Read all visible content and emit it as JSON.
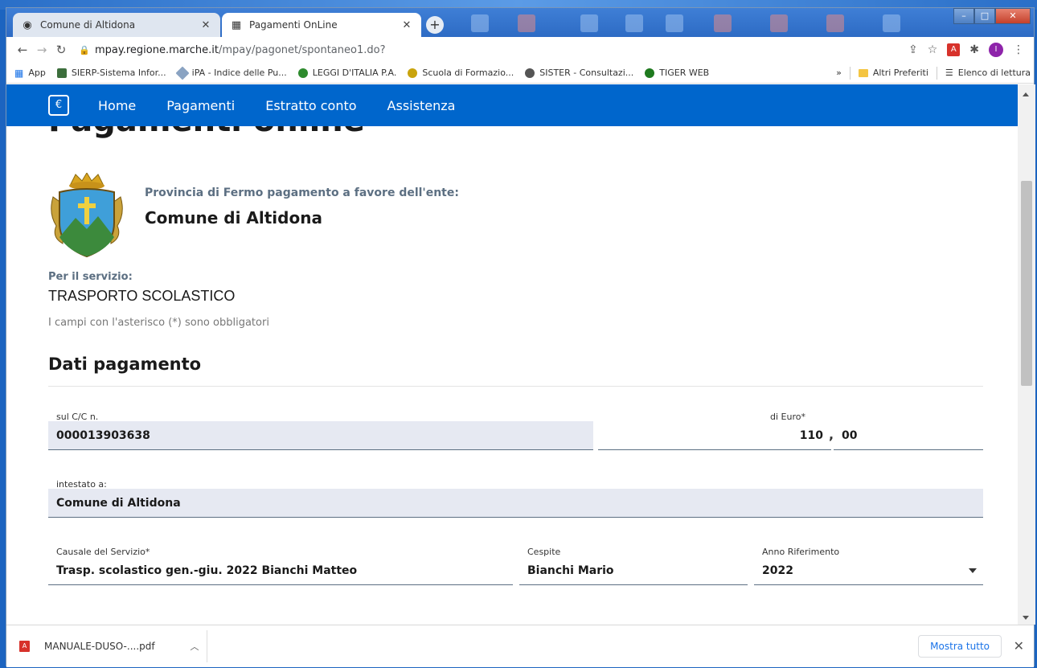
{
  "browser": {
    "tabs": [
      {
        "title": "Comune di Altidona",
        "active": false
      },
      {
        "title": "Pagamenti OnLine",
        "active": true
      }
    ],
    "new_tab": "+",
    "url_host": "mpay.regione.marche.it",
    "url_path": "/mpay/pagonet/spontaneo1.do?",
    "profile_initial": "I",
    "bookmarks": [
      {
        "label": "App",
        "color": "#1a73e8"
      },
      {
        "label": "SIERP-Sistema Infor...",
        "color": "#3c6e3c"
      },
      {
        "label": "iPA - Indice delle Pu...",
        "color": "#8aa3c2"
      },
      {
        "label": "LEGGI D'ITALIA P.A.",
        "color": "#2e8b2e"
      },
      {
        "label": "Scuola di Formazio...",
        "color": "#c9a40d"
      },
      {
        "label": "SISTER - Consultazi...",
        "color": "#555555"
      },
      {
        "label": "TIGER WEB",
        "color": "#1f7a1f"
      }
    ],
    "bookmarks_more": "»",
    "other_bookmarks": "Altri Preferiti",
    "reading_list": "Elenco di lettura"
  },
  "site_nav": {
    "items": [
      "Home",
      "Pagamenti",
      "Estratto conto",
      "Assistenza"
    ]
  },
  "page": {
    "title": "Pagamenti online",
    "ente_caption": "Provincia di Fermo pagamento a favore dell'ente:",
    "ente_name": "Comune di Altidona",
    "service_caption": "Per il servizio:",
    "service_name": "TRASPORTO SCOLASTICO",
    "required_note": "I campi con l'asterisco (*) sono obbligatori",
    "section_title": "Dati pagamento"
  },
  "form": {
    "cc_label": "sul C/C n.",
    "cc_value": "000013903638",
    "euro_label": "di Euro*",
    "euro_int": "110",
    "euro_sep": ",",
    "euro_dec": "00",
    "intestato_label": "intestato a:",
    "intestato_value": "Comune di Altidona",
    "causale_label": "Causale del Servizio*",
    "causale_value": "Trasp. scolastico gen.-giu. 2022  Bianchi  Matteo",
    "cespite_label": "Cespite",
    "cespite_value": "Bianchi Mario",
    "anno_label": "Anno Riferimento",
    "anno_value": "2022"
  },
  "downloads": {
    "file": "MANUALE-DUSO-....pdf",
    "show_all": "Mostra tutto"
  },
  "colors": {
    "nav_blue": "#0066cc",
    "readonly_field": "#e6e9f2",
    "label_gray": "#5c6f82"
  }
}
